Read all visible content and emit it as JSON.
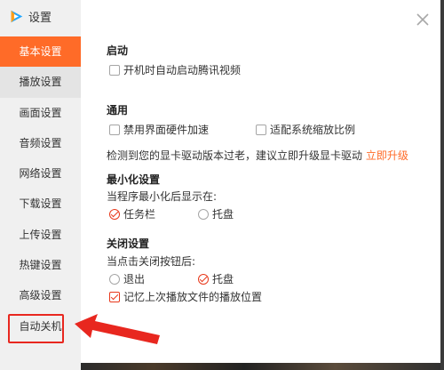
{
  "window": {
    "title": "设置",
    "logo_icon": "tencent-video-logo-icon"
  },
  "sidebar": {
    "items": [
      {
        "label": "基本设置",
        "state": "active"
      },
      {
        "label": "播放设置"
      },
      {
        "label": "画面设置"
      },
      {
        "label": "音频设置"
      },
      {
        "label": "网络设置"
      },
      {
        "label": "下载设置"
      },
      {
        "label": "上传设置"
      },
      {
        "label": "热键设置"
      },
      {
        "label": "高级设置"
      },
      {
        "label": "自动关机",
        "highlighted": true
      }
    ]
  },
  "content": {
    "startup": {
      "title": "启动",
      "autostart": {
        "label": "开机时自动启动腾讯视频",
        "checked": false
      }
    },
    "general": {
      "title": "通用",
      "disable_hw_accel": {
        "label": "禁用界面硬件加速",
        "checked": false
      },
      "adapt_scaling": {
        "label": "适配系统缩放比例",
        "checked": false
      },
      "driver_notice": "检测到您的显卡驱动版本过老，建议立即升级显卡驱动",
      "upgrade_link": "立即升级"
    },
    "minimize": {
      "title": "最小化设置",
      "prompt": "当程序最小化后显示在:",
      "options": [
        {
          "label": "任务栏",
          "checked": true
        },
        {
          "label": "托盘",
          "checked": false
        }
      ]
    },
    "close": {
      "title": "关闭设置",
      "prompt": "当点击关闭按钮后:",
      "options": [
        {
          "label": "退出",
          "checked": false
        },
        {
          "label": "托盘",
          "checked": true
        }
      ],
      "remember_position": {
        "label": "记忆上次播放文件的播放位置",
        "checked": true
      }
    }
  },
  "colors": {
    "accent": "#ff6b28",
    "annotation_red": "#e8271f",
    "sidebar_bg": "#f0f0f0"
  }
}
